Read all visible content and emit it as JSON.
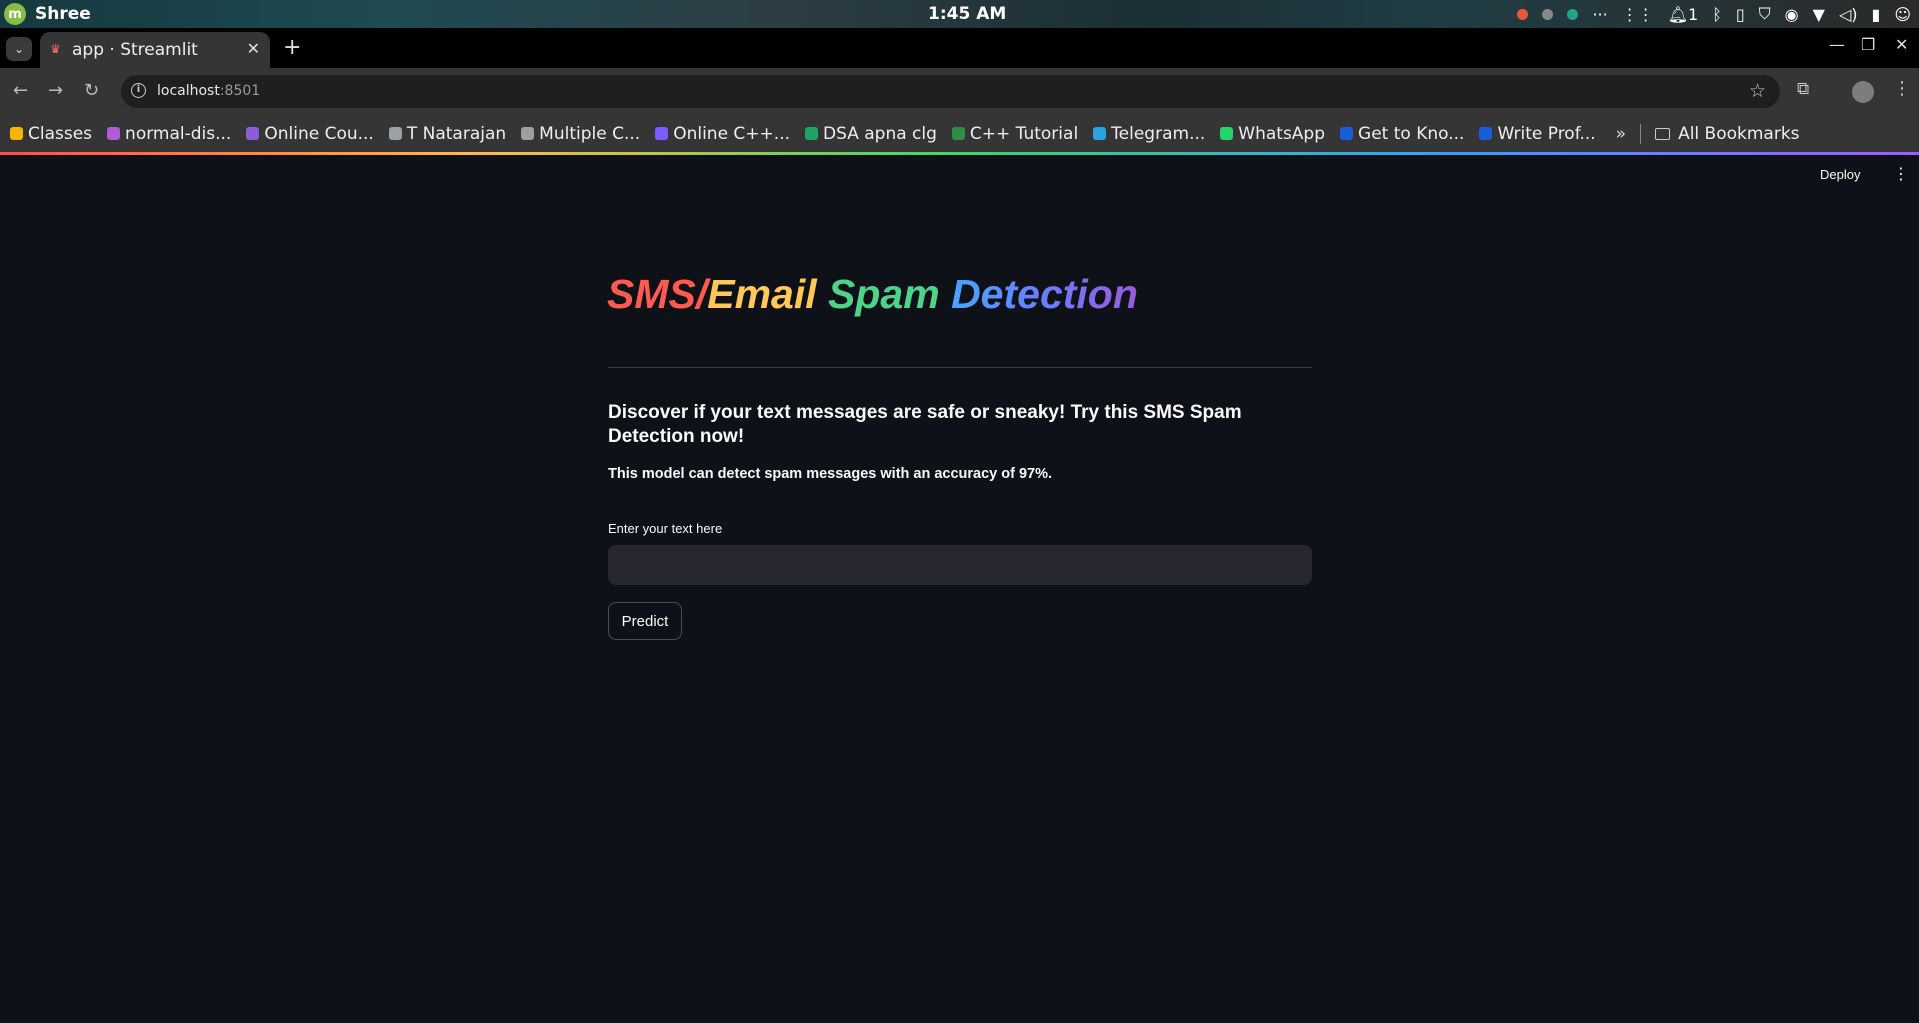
{
  "os_panel": {
    "username": "Shree",
    "clock": "1:45 AM",
    "notification_count": "1"
  },
  "browser": {
    "tab_title": "app · Streamlit",
    "url_host": "localhost",
    "url_port": ":8501",
    "bookmarks": [
      {
        "label": "Classes",
        "color": "#f4b400"
      },
      {
        "label": "normal-dis...",
        "color": "#b05bd8"
      },
      {
        "label": "Online Cou...",
        "color": "#8f5bd8"
      },
      {
        "label": "T Natarajan",
        "color": "#9aa0a6"
      },
      {
        "label": "Multiple C...",
        "color": "#9aa0a6"
      },
      {
        "label": "Online C++...",
        "color": "#7c5cff"
      },
      {
        "label": "DSA apna clg",
        "color": "#1fa463"
      },
      {
        "label": "C++ Tutorial",
        "color": "#2f8d46"
      },
      {
        "label": "Telegram...",
        "color": "#2aa3df"
      },
      {
        "label": "WhatsApp",
        "color": "#25d366"
      },
      {
        "label": "Get to Kno...",
        "color": "#1a5dd8"
      },
      {
        "label": "Write Prof...",
        "color": "#1a5dd8"
      }
    ],
    "bookmarks_more": "»",
    "all_bookmarks": "All Bookmarks"
  },
  "app": {
    "deploy_label": "Deploy",
    "title_parts": [
      "SMS/",
      "Email ",
      "Spam ",
      "Detection"
    ],
    "subheader": "Discover if your text messages are safe or sneaky! Try this SMS Spam Detection now!",
    "accuracy_text": "This model can detect spam messages with an accuracy of 97%.",
    "input_label": "Enter your text here",
    "input_value": "",
    "predict_label": "Predict"
  }
}
